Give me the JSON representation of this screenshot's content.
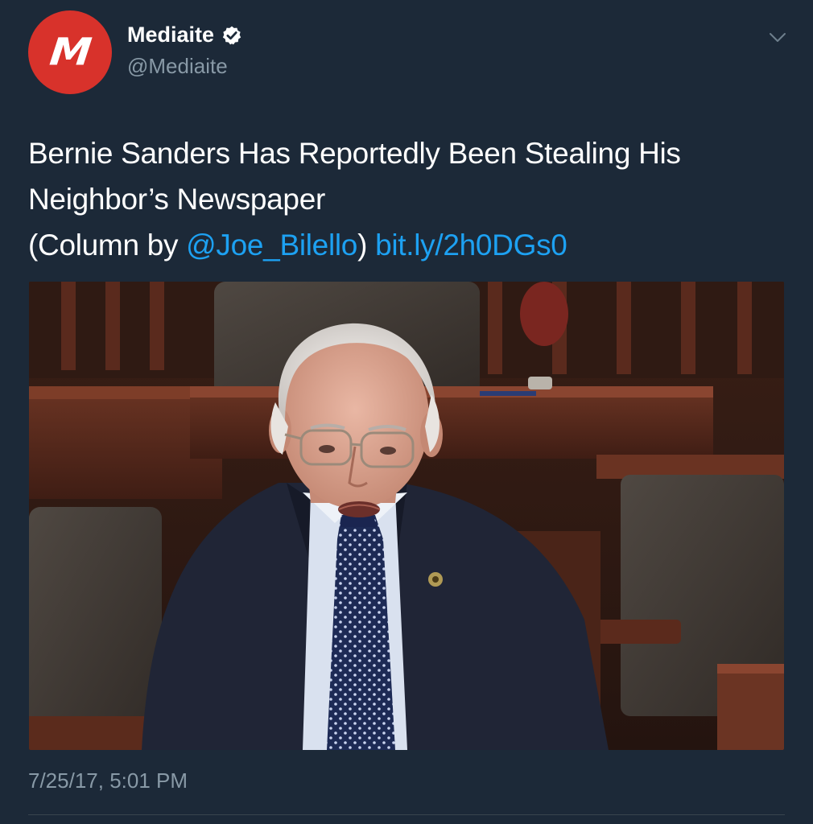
{
  "author": {
    "display_name": "Mediaite",
    "handle": "@Mediaite",
    "avatar_letter": "M",
    "avatar_color": "#d8322b",
    "verified": true,
    "verified_icon": "verified-badge-icon"
  },
  "menu_icon": "chevron-down-icon",
  "tweet": {
    "text_line1": "Bernie Sanders Has Reportedly Been Stealing His",
    "text_line2": "Neighbor’s Newspaper",
    "text_line3_prefix": "(Column by ",
    "mention": "@Joe_Bilello",
    "text_line3_mid": ") ",
    "url": "bit.ly/2h0DGs0",
    "timestamp": "7/25/17, 5:01 PM"
  },
  "colors": {
    "background": "#1c2938",
    "text": "#ffffff",
    "secondary_text": "#8899a6",
    "link": "#1da1f2",
    "divider": "#38444d"
  }
}
